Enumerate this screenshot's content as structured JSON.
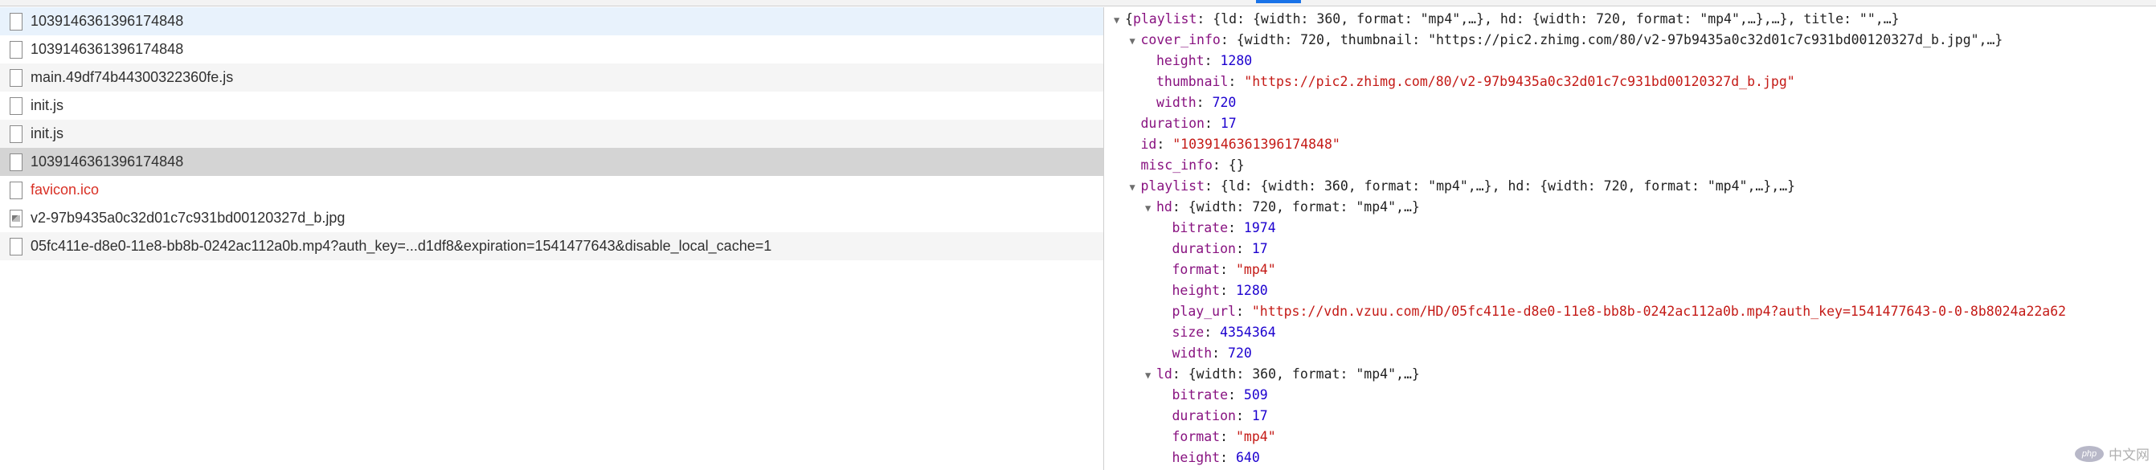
{
  "network_list": [
    {
      "name": "1039146361396174848",
      "style": "sel",
      "icon": "file"
    },
    {
      "name": "1039146361396174848",
      "style": "",
      "icon": "file"
    },
    {
      "name": "main.49df74b44300322360fe.js",
      "style": "alt",
      "icon": "file"
    },
    {
      "name": "init.js",
      "style": "",
      "icon": "file"
    },
    {
      "name": "init.js",
      "style": "alt",
      "icon": "file"
    },
    {
      "name": "1039146361396174848",
      "style": "hl",
      "icon": "file"
    },
    {
      "name": "favicon.ico",
      "style": "err",
      "icon": "file"
    },
    {
      "name": "v2-97b9435a0c32d01c7c931bd00120327d_b.jpg",
      "style": "",
      "icon": "image"
    },
    {
      "name": "05fc411e-d8e0-11e8-bb8b-0242ac112a0b.mp4?auth_key=...d1df8&expiration=1541477643&disable_local_cache=1",
      "style": "alt",
      "icon": "file"
    }
  ],
  "json_preview": [
    {
      "indent": 0,
      "tri": "▼",
      "parts": [
        [
          "p",
          "{"
        ],
        [
          "k",
          "playlist"
        ],
        [
          "p",
          ": {ld: {width: 360, format: \"mp4\",…}, hd: {width: 720, format: \"mp4\",…},…}, title: \"\",…}"
        ]
      ]
    },
    {
      "indent": 1,
      "tri": "▼",
      "parts": [
        [
          "k",
          "cover_info"
        ],
        [
          "p",
          ": {width: 720, thumbnail: \"https://pic2.zhimg.com/80/v2-97b9435a0c32d01c7c931bd00120327d_b.jpg\",…}"
        ]
      ]
    },
    {
      "indent": 2,
      "tri": "",
      "parts": [
        [
          "k",
          "height"
        ],
        [
          "p",
          ": "
        ],
        [
          "n",
          "1280"
        ]
      ]
    },
    {
      "indent": 2,
      "tri": "",
      "parts": [
        [
          "k",
          "thumbnail"
        ],
        [
          "p",
          ": "
        ],
        [
          "s",
          "\"https://pic2.zhimg.com/80/v2-97b9435a0c32d01c7c931bd00120327d_b.jpg\""
        ]
      ]
    },
    {
      "indent": 2,
      "tri": "",
      "parts": [
        [
          "k",
          "width"
        ],
        [
          "p",
          ": "
        ],
        [
          "n",
          "720"
        ]
      ]
    },
    {
      "indent": 1,
      "tri": "",
      "parts": [
        [
          "k",
          "duration"
        ],
        [
          "p",
          ": "
        ],
        [
          "n",
          "17"
        ]
      ]
    },
    {
      "indent": 1,
      "tri": "",
      "parts": [
        [
          "k",
          "id"
        ],
        [
          "p",
          ": "
        ],
        [
          "s",
          "\"1039146361396174848\""
        ]
      ]
    },
    {
      "indent": 1,
      "tri": "",
      "parts": [
        [
          "k",
          "misc_info"
        ],
        [
          "p",
          ": {}"
        ]
      ]
    },
    {
      "indent": 1,
      "tri": "▼",
      "parts": [
        [
          "k",
          "playlist"
        ],
        [
          "p",
          ": {ld: {width: 360, format: \"mp4\",…}, hd: {width: 720, format: \"mp4\",…},…}"
        ]
      ]
    },
    {
      "indent": 2,
      "tri": "▼",
      "parts": [
        [
          "k",
          "hd"
        ],
        [
          "p",
          ": {width: 720, format: \"mp4\",…}"
        ]
      ]
    },
    {
      "indent": 3,
      "tri": "",
      "parts": [
        [
          "k",
          "bitrate"
        ],
        [
          "p",
          ": "
        ],
        [
          "n",
          "1974"
        ]
      ]
    },
    {
      "indent": 3,
      "tri": "",
      "parts": [
        [
          "k",
          "duration"
        ],
        [
          "p",
          ": "
        ],
        [
          "n",
          "17"
        ]
      ]
    },
    {
      "indent": 3,
      "tri": "",
      "parts": [
        [
          "k",
          "format"
        ],
        [
          "p",
          ": "
        ],
        [
          "s",
          "\"mp4\""
        ]
      ]
    },
    {
      "indent": 3,
      "tri": "",
      "parts": [
        [
          "k",
          "height"
        ],
        [
          "p",
          ": "
        ],
        [
          "n",
          "1280"
        ]
      ]
    },
    {
      "indent": 3,
      "tri": "",
      "parts": [
        [
          "k",
          "play_url"
        ],
        [
          "p",
          ": "
        ],
        [
          "s",
          "\"https://vdn.vzuu.com/HD/05fc411e-d8e0-11e8-bb8b-0242ac112a0b.mp4?auth_key=1541477643-0-0-8b8024a22a62"
        ]
      ]
    },
    {
      "indent": 3,
      "tri": "",
      "parts": [
        [
          "k",
          "size"
        ],
        [
          "p",
          ": "
        ],
        [
          "n",
          "4354364"
        ]
      ]
    },
    {
      "indent": 3,
      "tri": "",
      "parts": [
        [
          "k",
          "width"
        ],
        [
          "p",
          ": "
        ],
        [
          "n",
          "720"
        ]
      ]
    },
    {
      "indent": 2,
      "tri": "▼",
      "parts": [
        [
          "k",
          "ld"
        ],
        [
          "p",
          ": {width: 360, format: \"mp4\",…}"
        ]
      ]
    },
    {
      "indent": 3,
      "tri": "",
      "parts": [
        [
          "k",
          "bitrate"
        ],
        [
          "p",
          ": "
        ],
        [
          "n",
          "509"
        ]
      ]
    },
    {
      "indent": 3,
      "tri": "",
      "parts": [
        [
          "k",
          "duration"
        ],
        [
          "p",
          ": "
        ],
        [
          "n",
          "17"
        ]
      ]
    },
    {
      "indent": 3,
      "tri": "",
      "parts": [
        [
          "k",
          "format"
        ],
        [
          "p",
          ": "
        ],
        [
          "s",
          "\"mp4\""
        ]
      ]
    },
    {
      "indent": 3,
      "tri": "",
      "parts": [
        [
          "k",
          "height"
        ],
        [
          "p",
          ": "
        ],
        [
          "n",
          "640"
        ]
      ]
    }
  ],
  "watermark": {
    "logo": "php",
    "text": "中文网"
  }
}
